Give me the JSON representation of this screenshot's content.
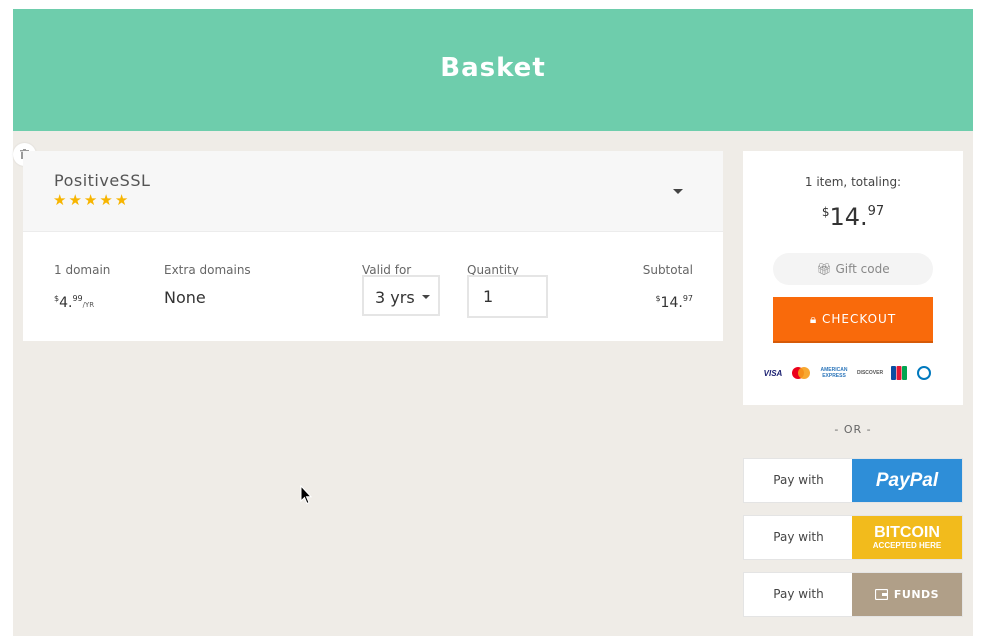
{
  "header": {
    "title": "Basket"
  },
  "product": {
    "name": "PositiveSSL",
    "rating_stars": 5,
    "columns": {
      "domain_label": "1 domain",
      "domain_price": {
        "currency": "$",
        "whole": "4.",
        "cents": "99",
        "period": "/YR"
      },
      "extra_label": "Extra domains",
      "extra_value": "None",
      "valid_label": "Valid for",
      "valid_value": "3 yrs",
      "qty_label": "Quantity",
      "qty_value": "1",
      "subtotal_label": "Subtotal",
      "subtotal_price": {
        "currency": "$",
        "whole": "14.",
        "cents": "97"
      }
    }
  },
  "summary": {
    "items_text": "1 item, totaling:",
    "total": {
      "currency": "$",
      "whole": "14.",
      "cents": "97"
    },
    "gift_label": "Gift code",
    "checkout_label": "CHECKOUT",
    "cards": [
      "VISA",
      "MasterCard",
      "AMERICAN EXPRESS",
      "DISCOVER",
      "JCB",
      "Diners Club"
    ]
  },
  "alternatives": {
    "or_text": "- OR -",
    "pay_with": "Pay with",
    "paypal": "PayPal",
    "bitcoin_main": "BITCOIN",
    "bitcoin_sub": "ACCEPTED HERE",
    "funds": "FUNDS"
  },
  "colors": {
    "header": "#6ecdac",
    "checkout": "#f96a0b",
    "paypal": "#2e8ed8",
    "bitcoin": "#f2bb1c",
    "funds": "#b09f88",
    "stars": "#f7b500"
  }
}
